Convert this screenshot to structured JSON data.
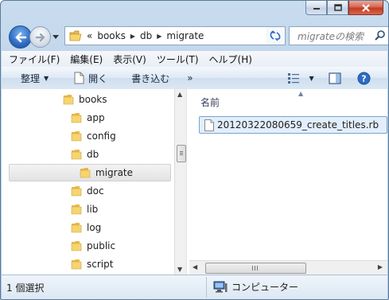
{
  "window": {
    "buttons": {
      "minimize": "minimize",
      "maximize": "maximize",
      "close": "close"
    }
  },
  "nav": {
    "back_icon": "back-arrow-icon",
    "forward_icon": "forward-arrow-icon",
    "breadcrumb": {
      "overflow": "«",
      "segments": [
        "books",
        "db",
        "migrate"
      ]
    },
    "search_placeholder": "migrateの検索"
  },
  "menu": [
    "ファイル(F)",
    "編集(E)",
    "表示(V)",
    "ツール(T)",
    "ヘルプ(H)"
  ],
  "toolbar": {
    "organize": "整理",
    "open": "開く",
    "burn": "書き込む",
    "more": "»"
  },
  "tree": {
    "items": [
      {
        "label": "books"
      },
      {
        "label": "app"
      },
      {
        "label": "config"
      },
      {
        "label": "db"
      },
      {
        "label": "migrate",
        "selected": true
      },
      {
        "label": "doc"
      },
      {
        "label": "lib"
      },
      {
        "label": "log"
      },
      {
        "label": "public"
      },
      {
        "label": "script"
      }
    ]
  },
  "files": {
    "column_header": "名前",
    "items": [
      {
        "name": "20120322080659_create_titles.rb"
      }
    ]
  },
  "status": {
    "selection": "1 個選択",
    "location": "コンピューター"
  },
  "colors": {
    "accent": "#2c6cc4",
    "folder": "#e8b84a",
    "selection": "#e2eefb"
  }
}
